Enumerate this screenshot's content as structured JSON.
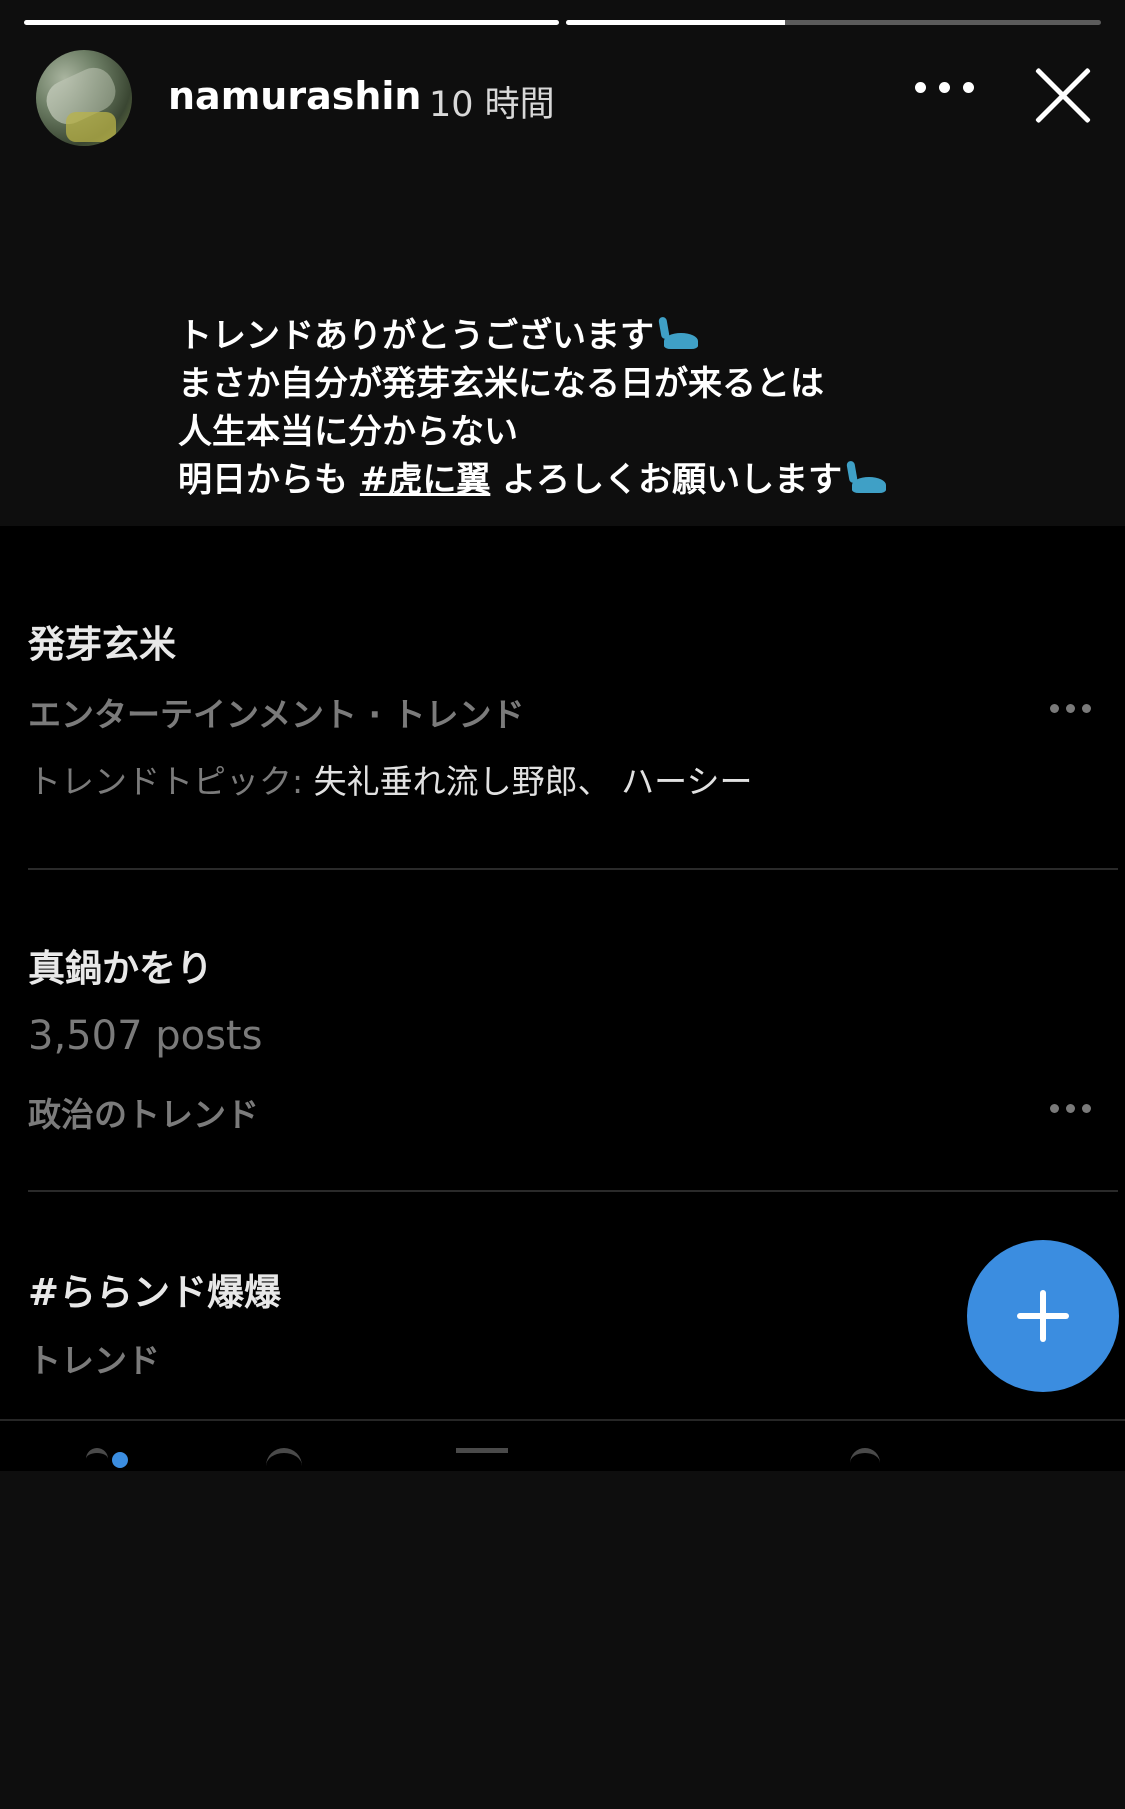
{
  "story": {
    "segment_progress": [
      1.0,
      0.41
    ],
    "username": "namurashin",
    "time": "10 時間",
    "caption": {
      "line1": "トレンドありがとうございます",
      "line2": "まさか自分が発芽玄米になる日が来るとは",
      "line3": "人生本当に分からない",
      "line4_a": "明日からも ",
      "line4_hashtag": "#虎に翼",
      "line4_b": " よろしくお願いします"
    }
  },
  "trends": [
    {
      "title": "発芽玄米",
      "category": "エンターテインメント · トレンド",
      "topics_label": "トレンドトピック: ",
      "topics": "失礼垂れ流し野郎、 ハーシー"
    },
    {
      "title": "真鍋かをり",
      "posts": "3,507 posts",
      "category": "政治のトレンド"
    },
    {
      "title": "#ららンド爆爆",
      "category": "トレンド"
    }
  ],
  "colors": {
    "background": "#0e0e0e",
    "fab": "#3b8de0",
    "dino_emoji": "#3fa0c6"
  },
  "icons": [
    "more-icon",
    "close-icon",
    "dinosaur-emoji-icon",
    "compose-plus-icon"
  ]
}
